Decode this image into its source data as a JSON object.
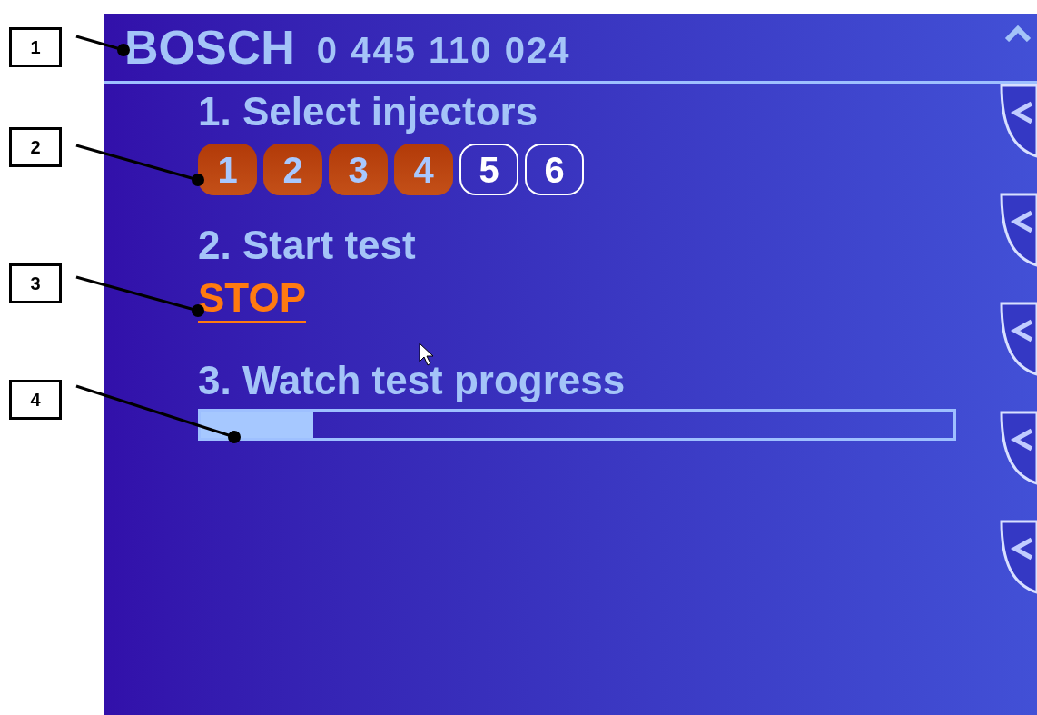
{
  "callouts": [
    {
      "label": "1"
    },
    {
      "label": "2"
    },
    {
      "label": "3"
    },
    {
      "label": "4"
    }
  ],
  "header": {
    "brand": "BOSCH",
    "part_number": "0 445 110 024"
  },
  "steps": [
    {
      "kind": "injectors",
      "title": "1. Select injectors",
      "injectors": [
        {
          "label": "1",
          "selected": true
        },
        {
          "label": "2",
          "selected": true
        },
        {
          "label": "3",
          "selected": true
        },
        {
          "label": "4",
          "selected": true
        },
        {
          "label": "5",
          "selected": false
        },
        {
          "label": "6",
          "selected": false
        }
      ]
    },
    {
      "kind": "action",
      "title": "2. Start test",
      "button": "STOP"
    },
    {
      "kind": "progress",
      "title": "3. Watch test progress",
      "level": 0.15
    }
  ]
}
